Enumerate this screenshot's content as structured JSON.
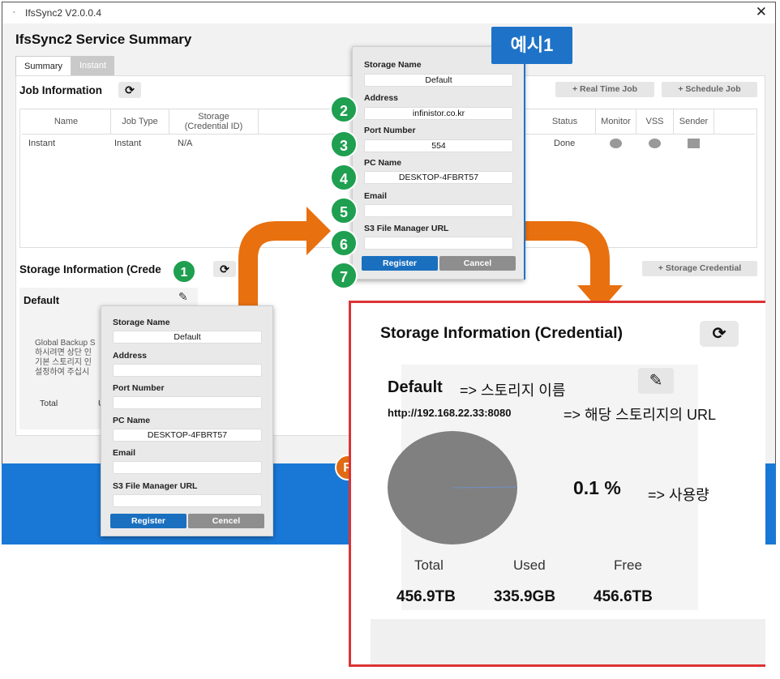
{
  "window": {
    "title": "IfsSync2 V2.0.0.4",
    "heading": "IfsSync2 Service Summary",
    "tabs": [
      "Summary",
      "Instant"
    ],
    "close_glyph": "✕"
  },
  "job": {
    "title": "Job Information",
    "buttons": [
      "+ Real Time Job",
      "+ Schedule Job"
    ],
    "columns": [
      "Name",
      "Job Type",
      "Storage\n(Credential ID)",
      "Status",
      "Monitor",
      "VSS",
      "Sender"
    ],
    "row": {
      "name": "Instant",
      "type": "Instant",
      "storage": "N/A",
      "status": "Done"
    }
  },
  "storage": {
    "title": "Storage Information (Credential)",
    "title_partial": "Storage Information (Crede",
    "add_button": "+ Storage Credential",
    "card_title": "Default",
    "note_lines": [
      "Global Backup S",
      "하시려면 상단 인",
      "기본 스토리지 인",
      "설정하여 주십시"
    ],
    "total_label": "Total",
    "total_u": "U"
  },
  "popup_empty": {
    "labels": [
      "Storage Name",
      "Address",
      "Port Number",
      "PC Name",
      "Email",
      "S3 File Manager URL"
    ],
    "values": [
      "Default",
      "",
      "",
      "DESKTOP-4FBRT57",
      "",
      ""
    ],
    "register": "Register",
    "cancel": "Cencel"
  },
  "popup_filled": {
    "labels": [
      "Storage Name",
      "Address",
      "Port Number",
      "PC Name",
      "Email",
      "S3 File Manager URL"
    ],
    "values": [
      "Default",
      "infinistor.co.kr",
      "554",
      "DESKTOP-4FBRT57",
      "",
      ""
    ],
    "register": "Register",
    "cancel": "Cancel"
  },
  "badges": [
    "1",
    "2",
    "3",
    "4",
    "5",
    "6",
    "7",
    "R"
  ],
  "example_tag": "예시1",
  "zoom": {
    "title": "Storage Information (Credential)",
    "name": "Default",
    "name_note": "=> 스토리지 이름",
    "url": "http://192.168.22.33:8080",
    "url_note": "=> 해당 스토리지의 URL",
    "percent": "0.1 %",
    "percent_note": "=> 사용량",
    "stats_labels": [
      "Total",
      "Used",
      "Free"
    ],
    "stats_values": [
      "456.9TB",
      "335.9GB",
      "456.6TB"
    ]
  },
  "colors": {
    "accent": "#1a6fbf",
    "badge_green": "#1f9f50",
    "arrow_orange": "#e8700f",
    "highlight_red": "#dd3333",
    "pie": "#808080"
  }
}
